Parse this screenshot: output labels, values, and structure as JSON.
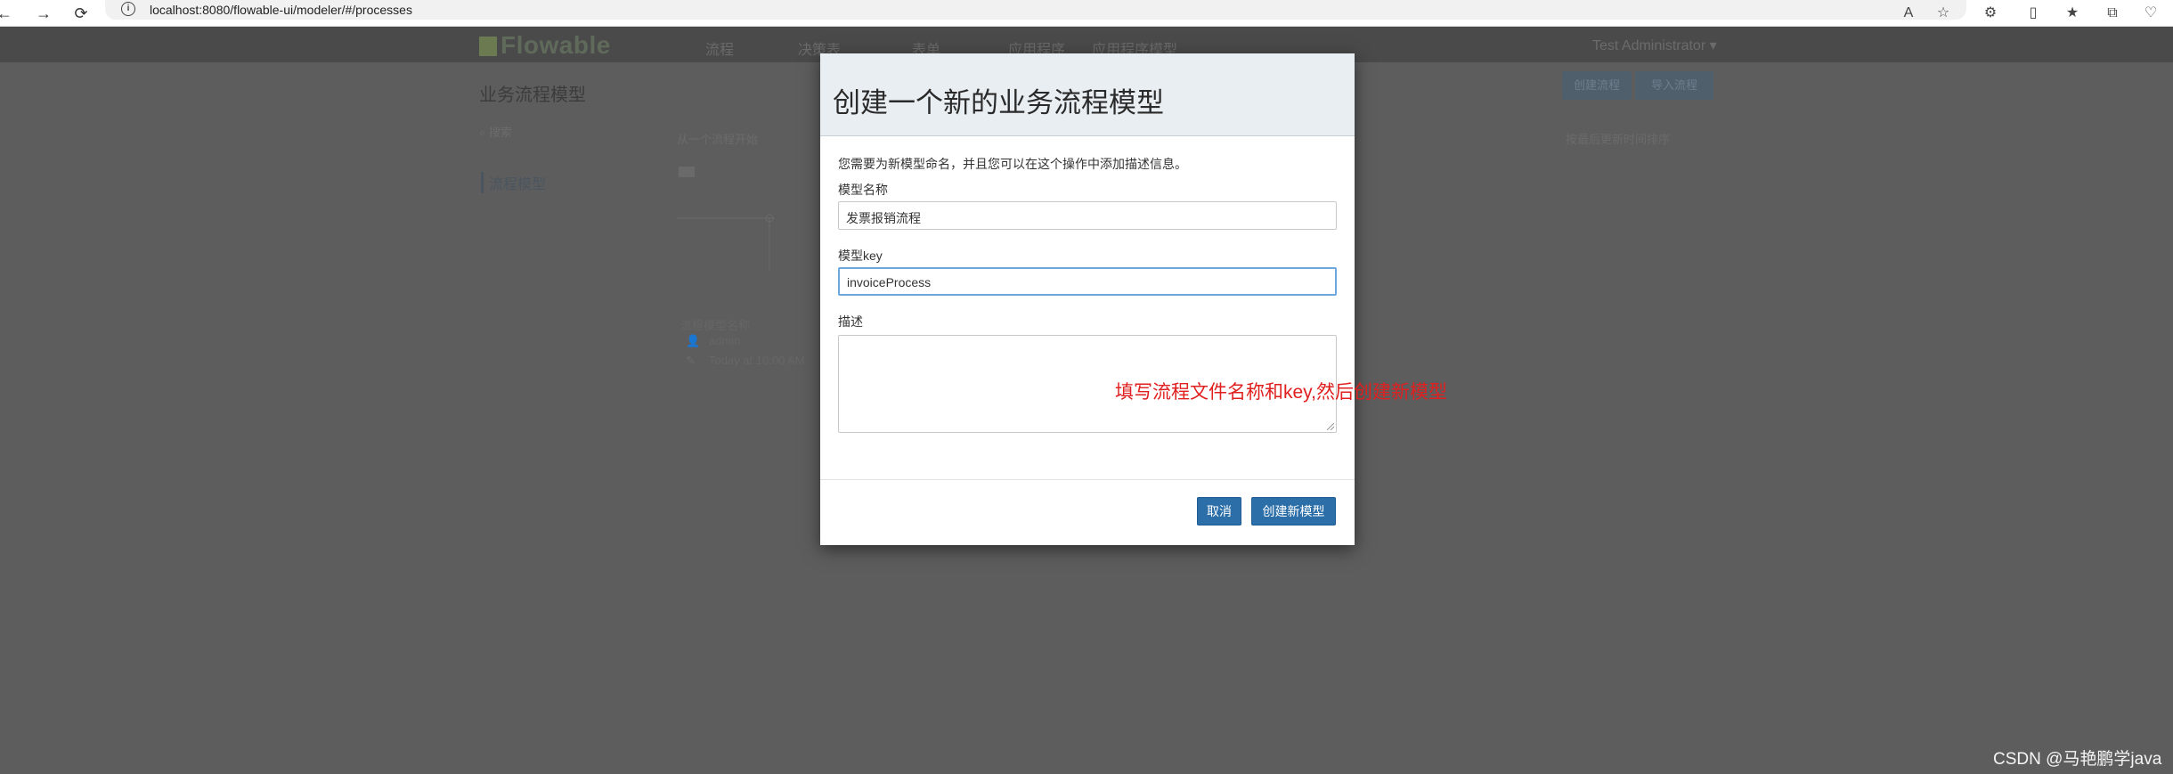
{
  "browser": {
    "url": "localhost:8080/flowable-ui/modeler/#/processes",
    "info_icon": "i"
  },
  "app": {
    "logo": "Flowable",
    "nav": [
      "流程",
      "决策表",
      "表单",
      "应用程序",
      "应用程序模型"
    ],
    "user": "Test Administrator",
    "page_title": "业务流程模型",
    "buttons": [
      "创建流程",
      "导入流程"
    ],
    "search_placeholder": "搜索",
    "filter_label": "从一个流程开始",
    "sort_label": "按最后更新时间排序",
    "side_link": "流程模型",
    "meta_title": "流程模型名称",
    "meta_user": "admin",
    "meta_date": "Today at 10:00 AM"
  },
  "modal": {
    "title": "创建一个新的业务流程模型",
    "intro": "您需要为新模型命名，并且您可以在这个操作中添加描述信息。",
    "name_label": "模型名称",
    "name_value": "发票报销流程",
    "key_label": "模型key",
    "key_value": "invoiceProcess",
    "desc_label": "描述",
    "desc_value": "",
    "cancel": "取消",
    "create": "创建新模型"
  },
  "annotation": "填写流程文件名称和key,然后创建新模型",
  "watermark": "CSDN @马艳鹏学java"
}
